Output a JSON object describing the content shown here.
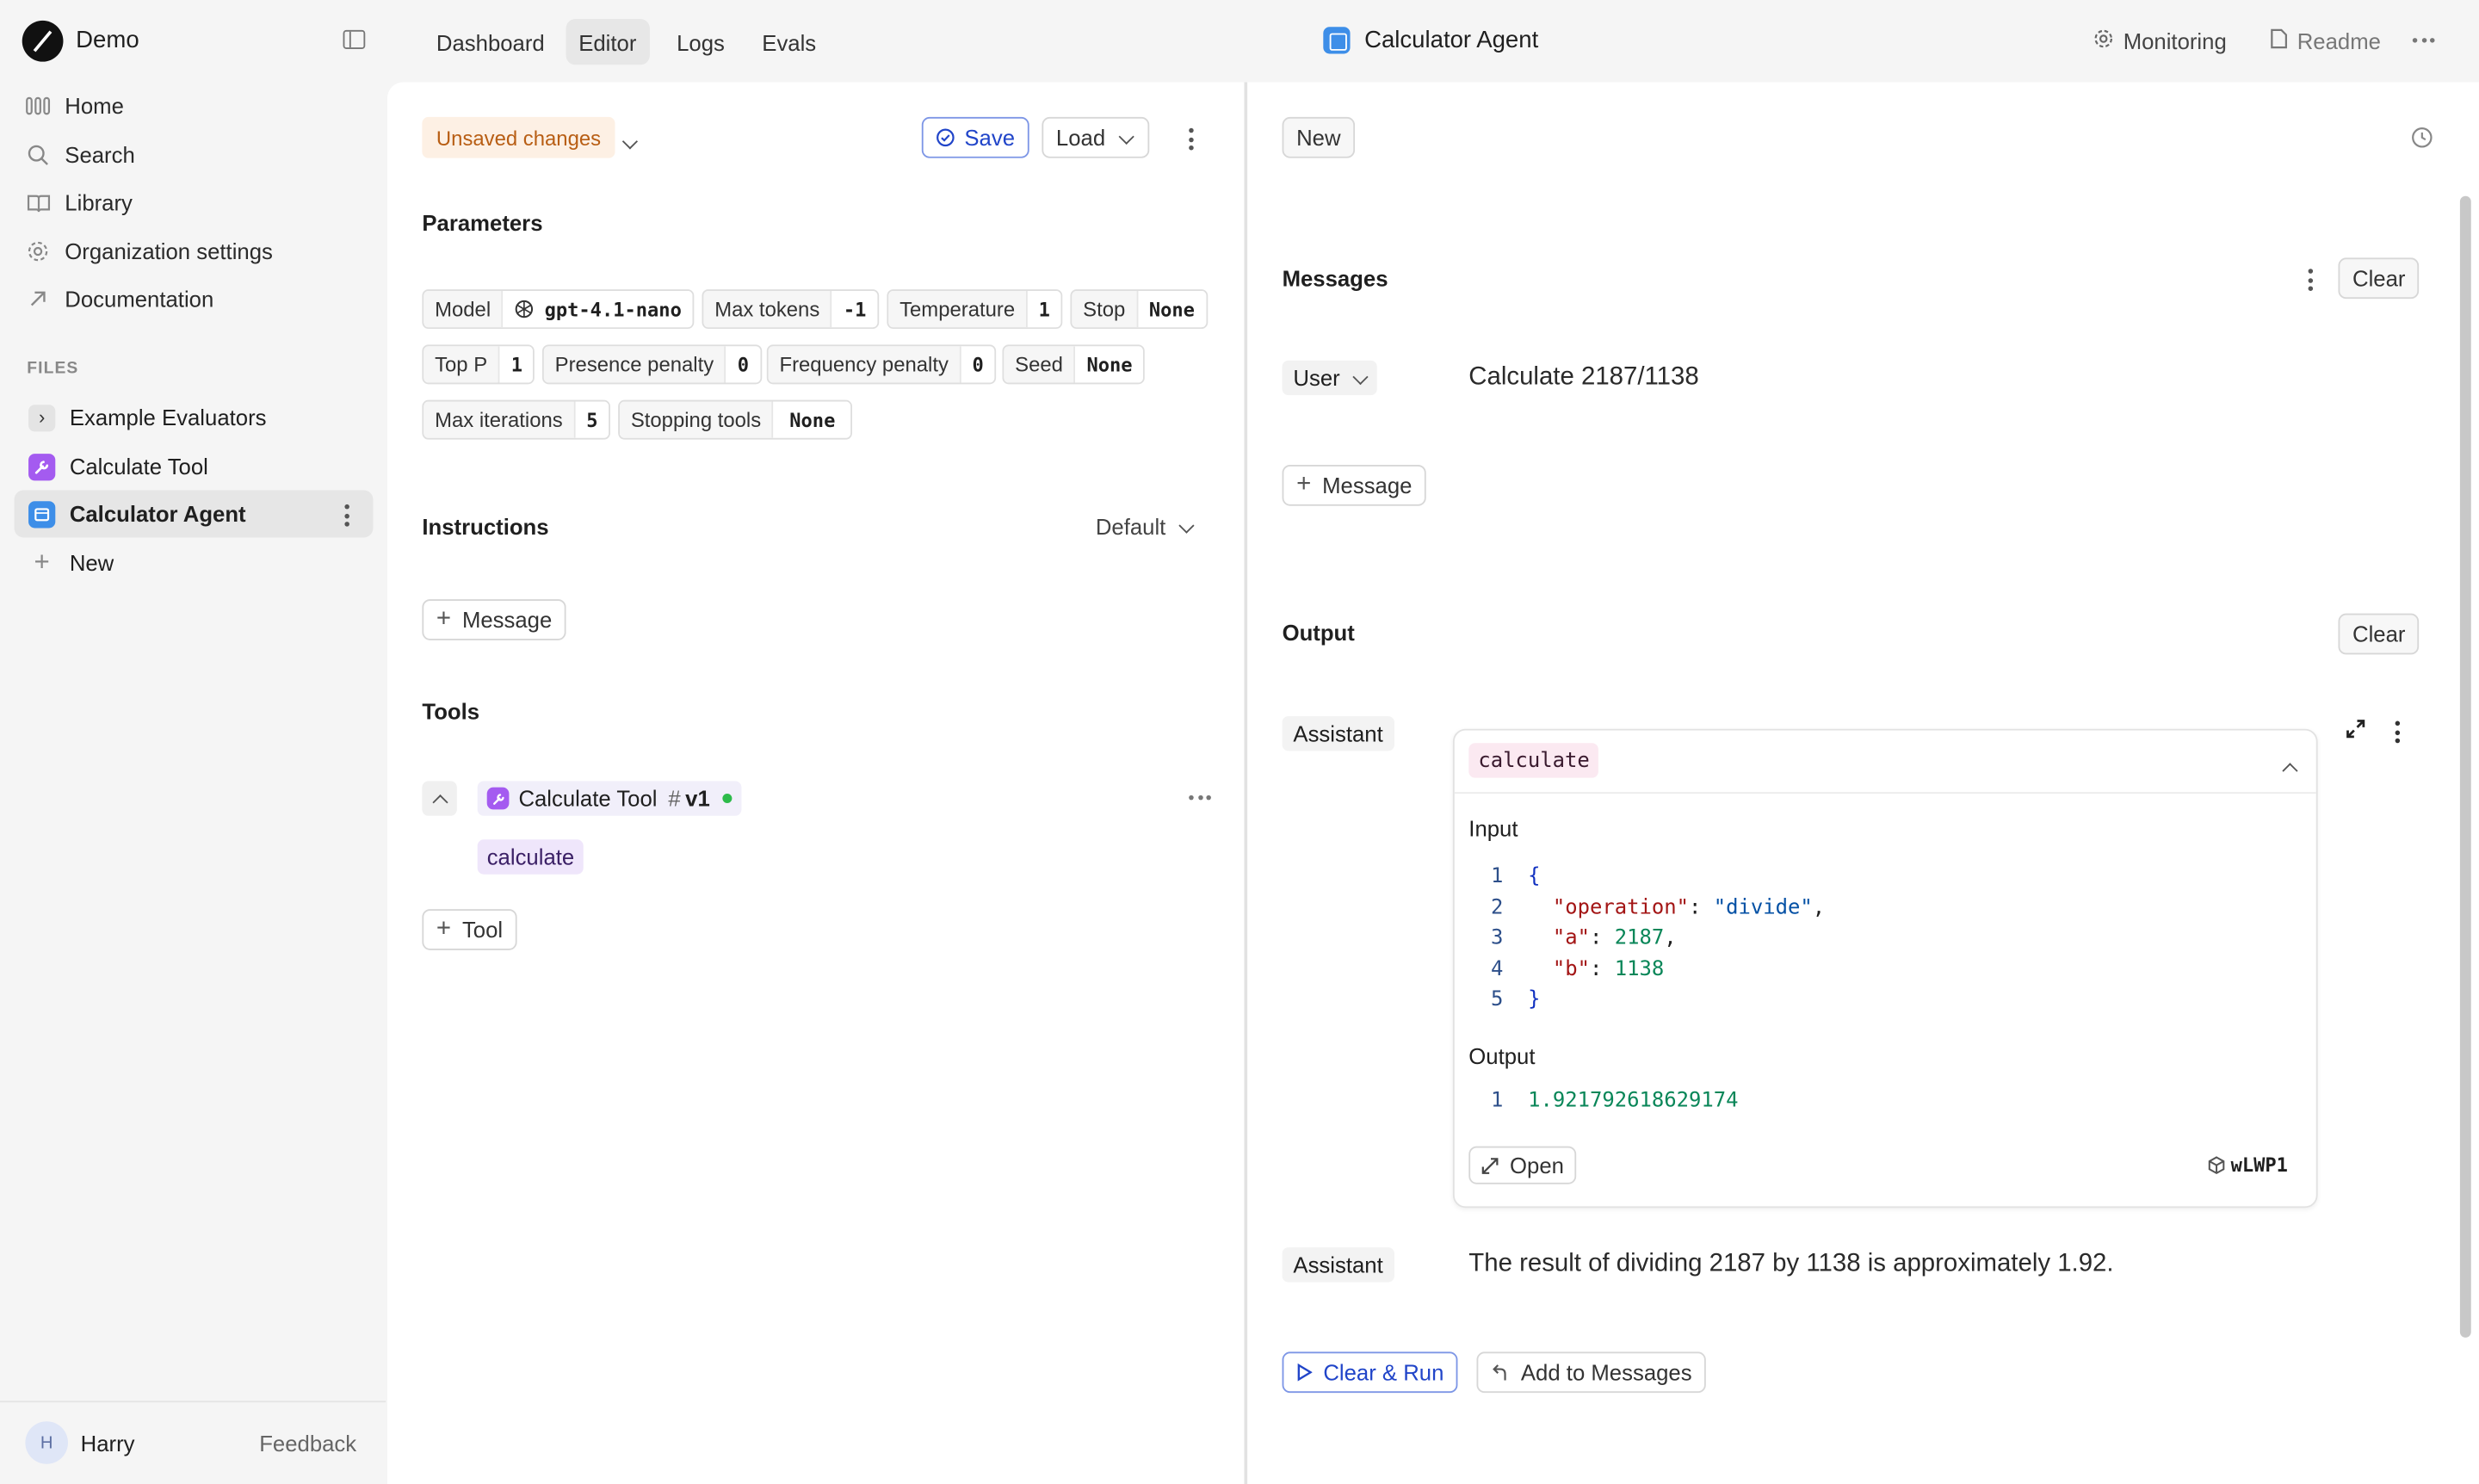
{
  "sidebar": {
    "brand": "Demo",
    "nav": [
      {
        "label": "Home",
        "icon": "home-icon"
      },
      {
        "label": "Search",
        "icon": "search-icon"
      },
      {
        "label": "Library",
        "icon": "library-icon"
      },
      {
        "label": "Organization settings",
        "icon": "gear-icon"
      },
      {
        "label": "Documentation",
        "icon": "external-link-icon"
      }
    ],
    "files_label": "FILES",
    "files": [
      {
        "label": "Example Evaluators",
        "icon": "chevron-right-icon"
      },
      {
        "label": "Calculate Tool",
        "icon": "wrench-icon"
      },
      {
        "label": "Calculator Agent",
        "icon": "agent-icon"
      },
      {
        "label": "New",
        "icon": "plus-icon"
      }
    ],
    "user": {
      "initial": "H",
      "name": "Harry"
    },
    "feedback": "Feedback"
  },
  "topbar": {
    "tabs": [
      "Dashboard",
      "Editor",
      "Logs",
      "Evals"
    ],
    "active_tab": "Editor",
    "title": "Calculator Agent",
    "monitoring": "Monitoring",
    "readme": "Readme"
  },
  "editor": {
    "unsaved": "Unsaved changes",
    "save": "Save",
    "load": "Load",
    "parameters_title": "Parameters",
    "params": [
      {
        "k": "Model",
        "v": "gpt-4.1-nano"
      },
      {
        "k": "Max tokens",
        "v": "-1"
      },
      {
        "k": "Temperature",
        "v": "1"
      },
      {
        "k": "Stop",
        "v": "None"
      },
      {
        "k": "Top P",
        "v": "1"
      },
      {
        "k": "Presence penalty",
        "v": "0"
      },
      {
        "k": "Frequency penalty",
        "v": "0"
      },
      {
        "k": "Seed",
        "v": "None"
      },
      {
        "k": "Max iterations",
        "v": "5"
      },
      {
        "k": "Stopping tools",
        "v": "None"
      }
    ],
    "instructions_title": "Instructions",
    "instructions_default": "Default",
    "message_btn": "Message",
    "tools_title": "Tools",
    "tool_name": "Calculate Tool",
    "tool_version": "v1",
    "tool_function": "calculate",
    "tool_btn": "Tool"
  },
  "run": {
    "new_btn": "New",
    "messages_title": "Messages",
    "clear": "Clear",
    "user_role": "User",
    "user_message": "Calculate 2187/1138",
    "message_btn": "Message",
    "output_title": "Output",
    "assistant_role": "Assistant",
    "tool_call": {
      "name": "calculate",
      "input_label": "Input",
      "input_lines": [
        "{",
        "  \"operation\": \"divide\",",
        "  \"a\": 2187,",
        "  \"b\": 1138",
        "}"
      ],
      "output_label": "Output",
      "output_value": "1.921792618629174",
      "open_btn": "Open",
      "trace_id": "wLWP1"
    },
    "final_answer": "The result of dividing 2187 by 1138 is approximately 1.92.",
    "clear_run": "Clear & Run",
    "add_to_messages": "Add to Messages"
  },
  "colors": {
    "accent": "#2145c9",
    "unsaved_bg": "#fdf0e4",
    "unsaved_text": "#b85e14",
    "tool_purple": "#a45bf0",
    "agent_blue": "#3d8ee8"
  }
}
